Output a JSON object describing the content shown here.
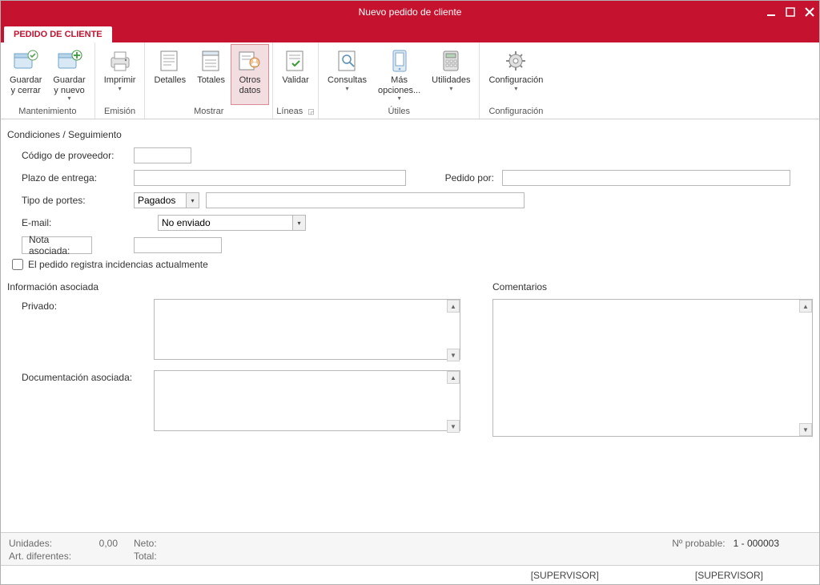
{
  "window": {
    "title": "Nuevo pedido de cliente"
  },
  "tab": {
    "label": "PEDIDO DE CLIENTE"
  },
  "ribbon": {
    "groups": {
      "mantenimiento": {
        "label": "Mantenimiento",
        "guardar_cerrar": "Guardar\ny cerrar",
        "guardar_nuevo": "Guardar\ny nuevo"
      },
      "emision": {
        "label": "Emisión",
        "imprimir": "Imprimir"
      },
      "mostrar": {
        "label": "Mostrar",
        "detalles": "Detalles",
        "totales": "Totales",
        "otros_datos": "Otros\ndatos"
      },
      "lineas": {
        "label": "Líneas",
        "validar": "Validar"
      },
      "utiles": {
        "label": "Útiles",
        "consultas": "Consultas",
        "mas_opciones": "Más\nopciones...",
        "utilidades": "Utilidades"
      },
      "config": {
        "label": "Configuración",
        "configuracion": "Configuración"
      }
    }
  },
  "sections": {
    "condiciones": "Condiciones / Seguimiento",
    "info_asociada": "Información asociada",
    "comentarios": "Comentarios"
  },
  "form": {
    "codigo_proveedor": {
      "label": "Código de proveedor:",
      "value": ""
    },
    "plazo_entrega": {
      "label": "Plazo de entrega:",
      "value": ""
    },
    "pedido_por": {
      "label": "Pedido por:",
      "value": ""
    },
    "tipo_portes": {
      "label": "Tipo de portes:",
      "value": "Pagados",
      "extra": ""
    },
    "email": {
      "label": "E-mail:",
      "value": "No enviado"
    },
    "nota_asociada": {
      "button": "Nota asociada:",
      "value": ""
    },
    "incidencias": {
      "label": "El pedido registra incidencias actualmente"
    },
    "privado": {
      "label": "Privado:",
      "value": ""
    },
    "doc_asociada": {
      "label": "Documentación asociada:",
      "value": ""
    },
    "comentarios_val": ""
  },
  "footer": {
    "unidades_label": "Unidades:",
    "unidades_value": "0,00",
    "art_dif_label": "Art. diferentes:",
    "art_dif_value": "",
    "neto_label": "Neto:",
    "total_label": "Total:",
    "probable_label": "Nº probable:",
    "probable_value": "1 - 000003"
  },
  "status": {
    "left": "[SUPERVISOR]",
    "right": "[SUPERVISOR]"
  }
}
